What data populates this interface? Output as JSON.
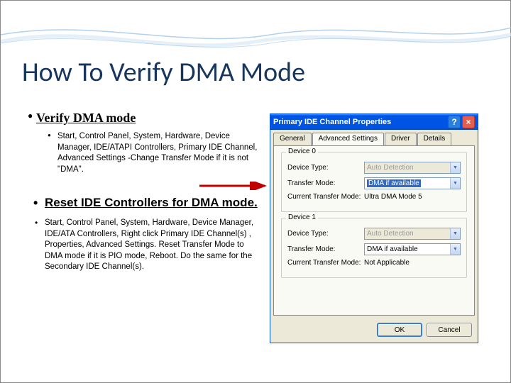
{
  "title": "How To Verify DMA Mode",
  "section1": {
    "heading": "Verify DMA mode",
    "body": "Start, Control Panel, System, Hardware, Device Manager, IDE/ATAPI Controllers, Primary IDE Channel, Advanced Settings -Change Transfer Mode if it is not \"DMA\"."
  },
  "section2": {
    "heading": "Reset IDE Controllers for DMA mode.",
    "body": "Start, Control Panel, System, Hardware, Device Manager, IDE/ATA Controllers, Right click Primary IDE Channel(s) , Properties, Advanced Settings.  Reset Transfer Mode to DMA mode if it is PIO mode, Reboot.   Do the same for the Secondary IDE Channel(s)."
  },
  "dialog": {
    "title": "Primary IDE Channel Properties",
    "tabs": [
      "General",
      "Advanced Settings",
      "Driver",
      "Details"
    ],
    "active_tab": "Advanced Settings",
    "device0": {
      "group_label": "Device 0",
      "type_label": "Device Type:",
      "type_value": "Auto Detection",
      "mode_label": "Transfer Mode:",
      "mode_value": "DMA if available",
      "current_label": "Current Transfer Mode:",
      "current_value": "Ultra DMA Mode 5"
    },
    "device1": {
      "group_label": "Device 1",
      "type_label": "Device Type:",
      "type_value": "Auto Detection",
      "mode_label": "Transfer Mode:",
      "mode_value": "DMA if available",
      "current_label": "Current Transfer Mode:",
      "current_value": "Not Applicable"
    },
    "ok": "OK",
    "cancel": "Cancel"
  }
}
